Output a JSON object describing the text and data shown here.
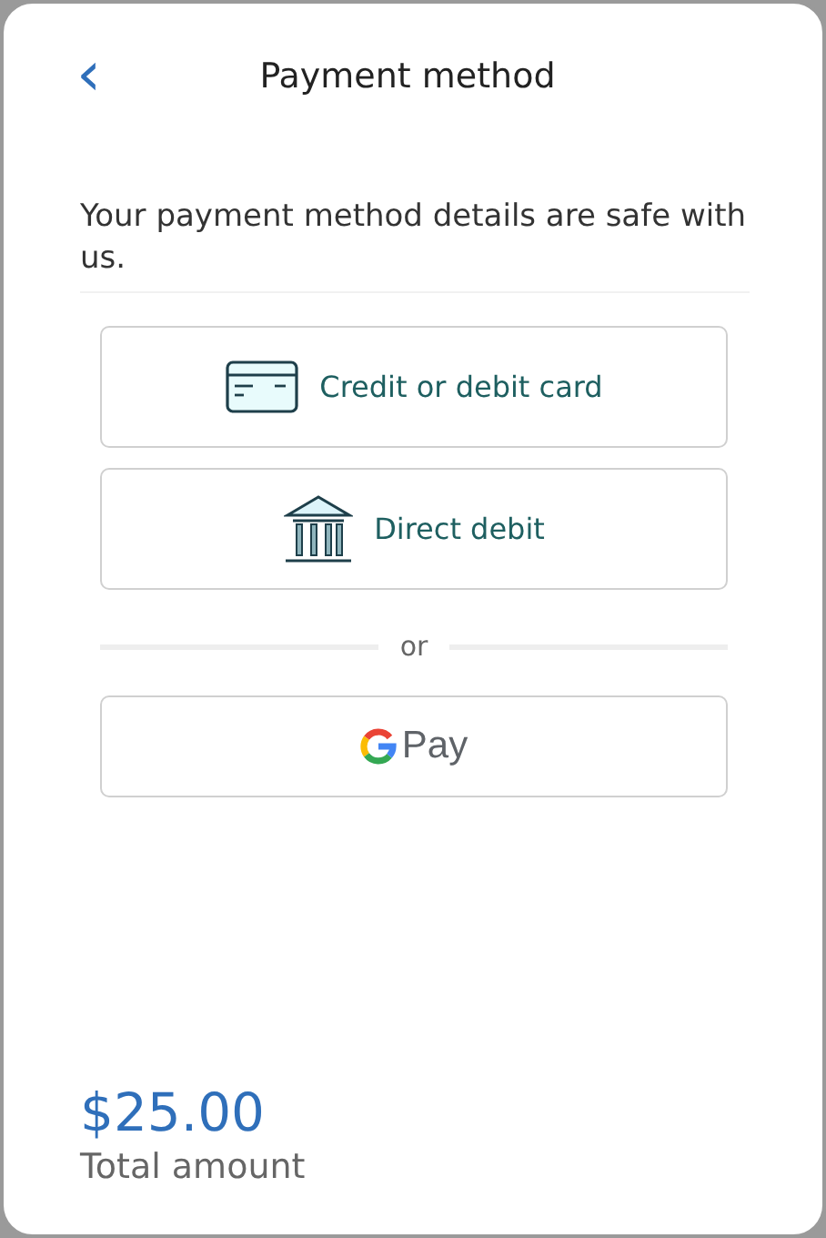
{
  "header": {
    "back": "‹",
    "title": "Payment method"
  },
  "notice": "Your payment method details are safe with us.",
  "methods": [
    {
      "kind": "card",
      "label": "Credit or debit card"
    },
    {
      "kind": "bank",
      "label": "Direct debit"
    }
  ],
  "divider": "or",
  "wallet": {
    "kind": "gpay",
    "label": "Pay"
  },
  "total": {
    "amount": "$25.00",
    "label": "Total amount"
  }
}
